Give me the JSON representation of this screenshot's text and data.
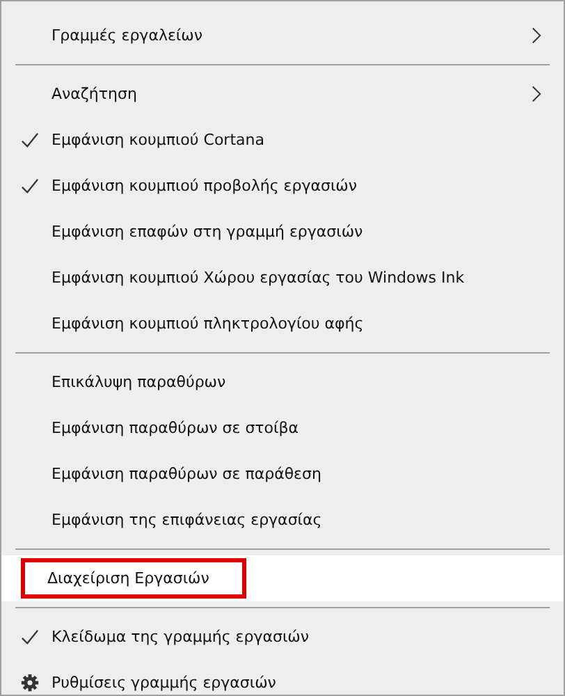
{
  "menu": {
    "groups": [
      {
        "items": [
          {
            "label": "Γραμμές εργαλείων",
            "kind": "submenu",
            "checked": false,
            "selected": false,
            "outlined": false
          }
        ]
      },
      {
        "items": [
          {
            "label": "Αναζήτηση",
            "kind": "submenu",
            "checked": false,
            "selected": false,
            "outlined": false
          },
          {
            "label": "Εμφάνιση κουμπιού Cortana",
            "kind": "plain",
            "checked": true,
            "selected": false,
            "outlined": false
          },
          {
            "label": "Εμφάνιση κουμπιού προβολής εργασιών",
            "kind": "plain",
            "checked": true,
            "selected": false,
            "outlined": false
          },
          {
            "label": "Εμφάνιση επαφών στη γραμμή εργασιών",
            "kind": "plain",
            "checked": false,
            "selected": false,
            "outlined": false
          },
          {
            "label": "Εμφάνιση κουμπιού Χώρου εργασίας του Windows Ink",
            "kind": "plain",
            "checked": false,
            "selected": false,
            "outlined": false
          },
          {
            "label": "Εμφάνιση κουμπιού πληκτρολογίου αφής",
            "kind": "plain",
            "checked": false,
            "selected": false,
            "outlined": false
          }
        ]
      },
      {
        "items": [
          {
            "label": "Επικάλυψη παραθύρων",
            "kind": "plain",
            "checked": false,
            "selected": false,
            "outlined": false
          },
          {
            "label": "Εμφάνιση παραθύρων σε στοίβα",
            "kind": "plain",
            "checked": false,
            "selected": false,
            "outlined": false
          },
          {
            "label": "Εμφάνιση παραθύρων σε παράθεση",
            "kind": "plain",
            "checked": false,
            "selected": false,
            "outlined": false
          },
          {
            "label": "Εμφάνιση της επιφάνειας εργασίας",
            "kind": "plain",
            "checked": false,
            "selected": false,
            "outlined": false
          }
        ]
      },
      {
        "items": [
          {
            "label": "Διαχείριση Εργασιών",
            "kind": "plain",
            "checked": false,
            "selected": true,
            "outlined": true
          }
        ]
      },
      {
        "items": [
          {
            "label": "Κλείδωμα της γραμμής εργασιών",
            "kind": "plain",
            "checked": true,
            "selected": false,
            "outlined": false
          },
          {
            "label": "Ρυθμίσεις γραμμής εργασιών",
            "kind": "settings",
            "checked": false,
            "selected": false,
            "outlined": false
          }
        ]
      }
    ]
  }
}
